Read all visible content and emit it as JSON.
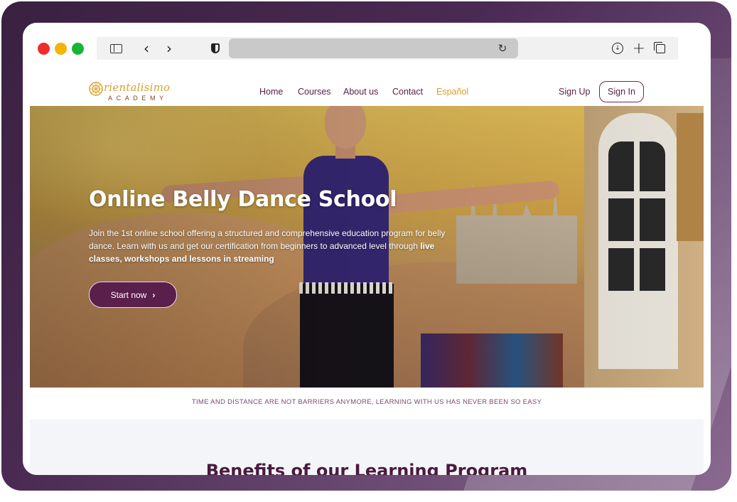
{
  "browser": {
    "url": "",
    "icons": [
      "sidebar-icon",
      "back-icon",
      "forward-icon",
      "shield-icon",
      "reload-icon",
      "download-icon",
      "plus-icon",
      "tabs-icon"
    ]
  },
  "site": {
    "logo": {
      "name": "rientalisimo",
      "sub": "ACADEMY"
    },
    "nav": [
      "Home",
      "Courses",
      "About us",
      "Contact",
      "Español"
    ],
    "sign_up": "Sign Up",
    "sign_in": "Sign In"
  },
  "hero": {
    "title": "Online Belly Dance School",
    "desc_plain": "Join the 1st online school offering a structured and comprehensive education program for belly dance. Learn with us and get our certification from beginners to advanced level through ",
    "desc_bold": "live classes, workshops and lessons in streaming",
    "cta": "Start now",
    "cta_icon": "›"
  },
  "tagline": "TIME AND DISTANCE ARE NOT BARRIERS ANYMORE, LEARNING WITH US HAS NEVER BEEN SO EASY",
  "benefits": {
    "title": "Benefits of our Learning Program"
  },
  "colors": {
    "brand": "#5b1f4c",
    "gold": "#d8a02e"
  }
}
